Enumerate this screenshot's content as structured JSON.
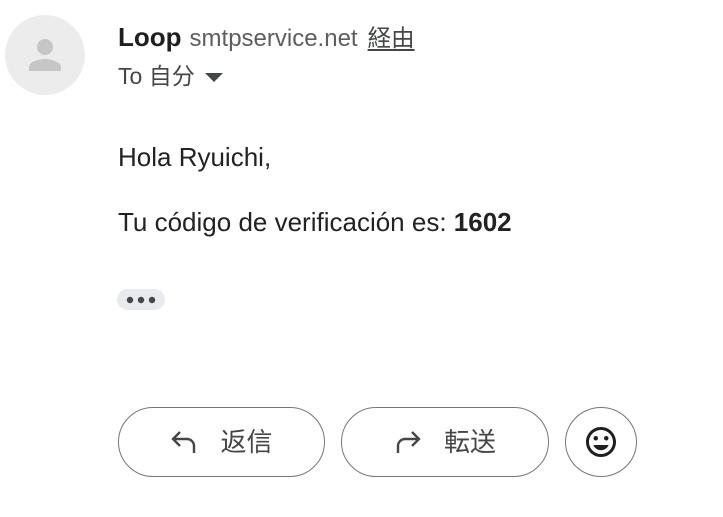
{
  "email_header": {
    "avatar_icon": "person-icon",
    "sender_name": "Loop",
    "sender_domain": "smtpservice.net",
    "via_label": "経由",
    "recipient_prefix": "To",
    "recipient_name": "自分",
    "recipient_toggle_icon": "arrow-drop-down-icon"
  },
  "message": {
    "greeting": "Hola Ryuichi,",
    "code_text": "Tu código de verificación es:",
    "code_value": "1602",
    "trimmed_content_icon": "more-horiz-icon"
  },
  "actions": {
    "reply_icon": "reply-icon",
    "reply_label": "返信",
    "forward_icon": "forward-icon",
    "forward_label": "転送",
    "reaction_icon": "add-emoji-reaction-icon"
  },
  "colors": {
    "text_primary": "#1f1f1f",
    "text_secondary": "#444746",
    "text_muted": "#5e5e5e",
    "body_text": "#222222",
    "button_border": "#747775",
    "pill_background": "#e8eaed",
    "avatar_background": "#ececec",
    "avatar_figure": "#c6c6c6"
  }
}
